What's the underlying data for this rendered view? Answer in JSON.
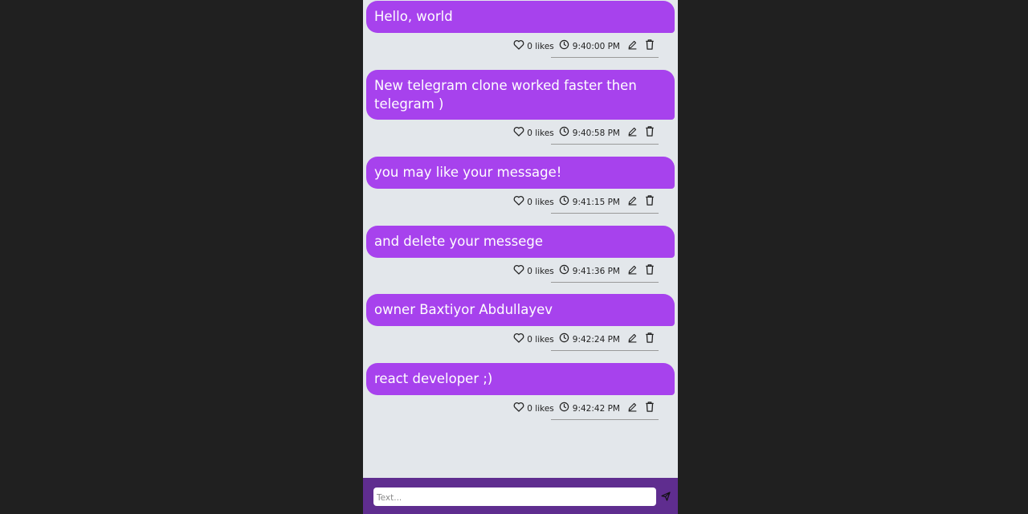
{
  "messages": [
    {
      "text": "Hello, world",
      "likes": "0 likes",
      "time": "9:40:00 PM"
    },
    {
      "text": "New telegram clone worked faster then telegram )",
      "likes": "0 likes",
      "time": "9:40:58 PM"
    },
    {
      "text": "you may like your message!",
      "likes": "0 likes",
      "time": "9:41:15 PM"
    },
    {
      "text": "and delete your messege",
      "likes": "0 likes",
      "time": "9:41:36 PM"
    },
    {
      "text": "owner Baxtiyor Abdullayev",
      "likes": "0 likes",
      "time": "9:42:24 PM"
    },
    {
      "text": "react developer ;)",
      "likes": "0 likes",
      "time": "9:42:42 PM"
    }
  ],
  "composer": {
    "placeholder": "Text...",
    "value": ""
  },
  "colors": {
    "bubble": "#a742ed",
    "composer_bar": "#5f2d8f",
    "chat_background": "#e3e7eb",
    "page_background": "#202020"
  },
  "icons": {
    "like": "heart-icon",
    "time": "clock-icon",
    "edit": "pencil-icon",
    "delete": "trash-icon",
    "send": "send-icon"
  }
}
